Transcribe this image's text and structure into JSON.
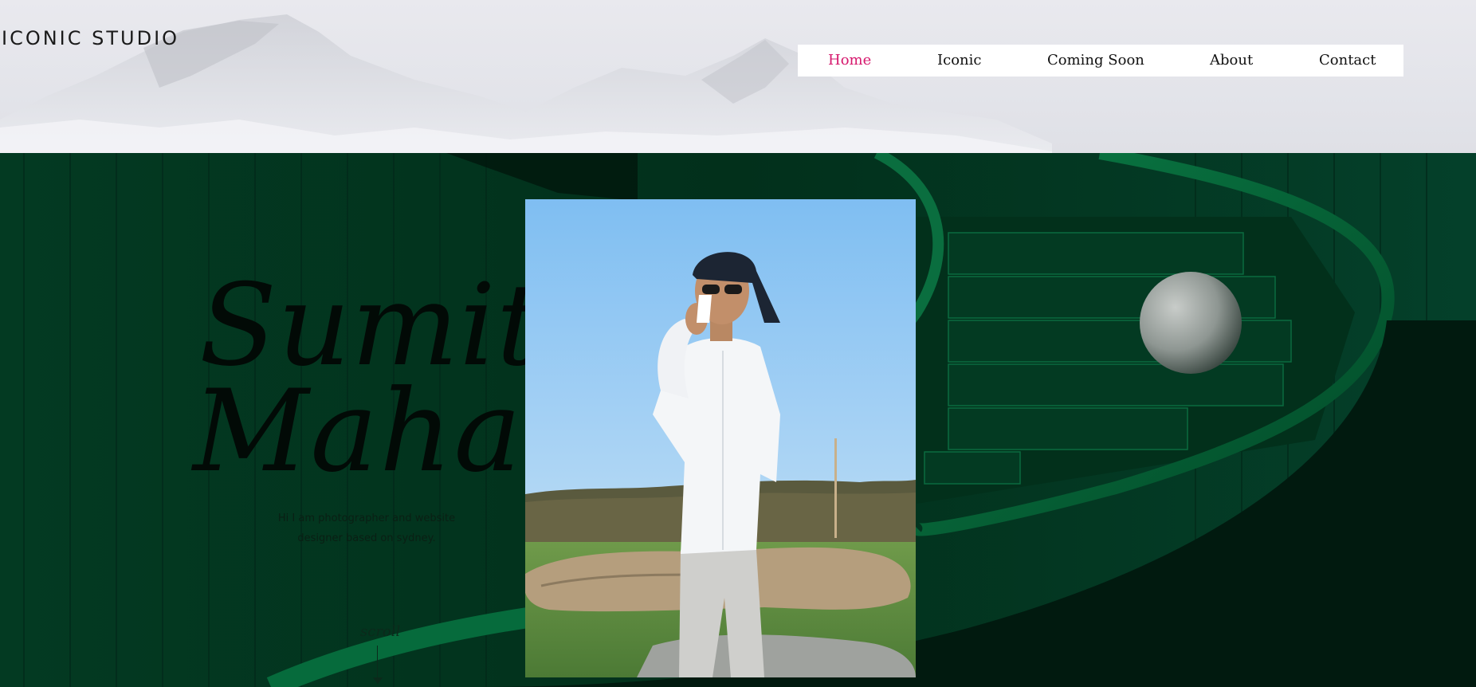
{
  "brand": {
    "logo_text": "ICONIC STUDIO"
  },
  "nav": {
    "items": [
      {
        "label": "Home",
        "active": true
      },
      {
        "label": "Iconic",
        "active": false
      },
      {
        "label": "Coming Soon",
        "active": false
      },
      {
        "label": "About",
        "active": false
      },
      {
        "label": "Contact",
        "active": false
      }
    ],
    "active_color": "#d6186d"
  },
  "hero": {
    "name_line1": "Sumit",
    "name_line2": "Mahat",
    "tagline_line1": "Hi I am photographer and website",
    "tagline_line2": "designer based on sydney.",
    "scroll_label": "scroll",
    "background_color": "#053d26",
    "photo_icon": "portrait-photo"
  }
}
